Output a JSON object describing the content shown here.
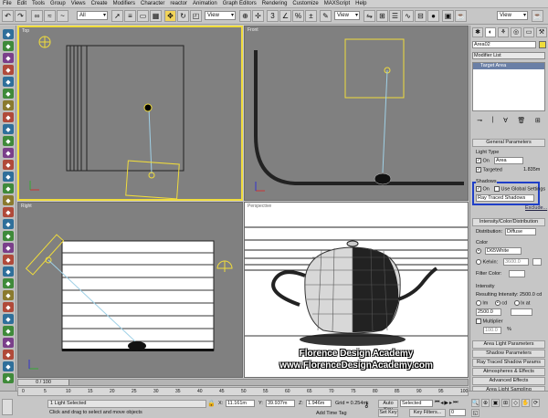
{
  "menu": [
    "File",
    "Edit",
    "Tools",
    "Group",
    "Views",
    "Create",
    "Modifiers",
    "Character",
    "reactor",
    "Animation",
    "Graph Editors",
    "Rendering",
    "Customize",
    "MAXScript",
    "Help"
  ],
  "toolbar": {
    "selection_filter": "All",
    "ref_coord": "View",
    "named_selection": "View"
  },
  "viewports": {
    "top": "Top",
    "front": "Front",
    "right": "Right",
    "perspective": "Perspective"
  },
  "command_panel": {
    "object_name": "Area02",
    "modifier_list": "Modifier List",
    "stack_item": "Target Area",
    "general_params": {
      "title": "General Parameters",
      "light_type_label": "Light Type",
      "on_label": "On",
      "type_value": "Area",
      "targeted_label": "Targeted",
      "targeted_value": "1.835m",
      "shadows_label": "Shadows",
      "shadows_on": "On",
      "use_global": "Use Global Settings",
      "shadow_type": "Ray Traced Shadows",
      "exclude": "Exclude..."
    },
    "intensity": {
      "title": "Intensity/Color/Distribution",
      "distribution_label": "Distribution:",
      "distribution_value": "Diffuse",
      "color_label": "Color",
      "color_preset": "D65White",
      "kelvin_label": "Kelvin:",
      "kelvin_value": "3600.0",
      "filter_label": "Filter Color:",
      "intensity_label": "Intensity",
      "resulting": "Resulting Intensity: 2500.0 cd",
      "lm": "lm",
      "cd": "cd",
      "lx": "lx at",
      "int_value": "2500.0",
      "multiplier_label": "Multiplier",
      "multiplier_value": "100.0",
      "percent": "%"
    },
    "rollouts": [
      "Area Light Parameters",
      "Shadow Parameters",
      "Ray Traced Shadow Params",
      "Atmospheres & Effects",
      "Advanced Effects",
      "Area Light Sampling"
    ]
  },
  "timeline": {
    "slider": "0 / 100",
    "ticks": [
      "0",
      "5",
      "10",
      "15",
      "20",
      "25",
      "30",
      "35",
      "40",
      "45",
      "50",
      "55",
      "60",
      "65",
      "70",
      "75",
      "80",
      "85",
      "90",
      "95",
      "100"
    ]
  },
  "status": {
    "selected": "1 Light Selected",
    "prompt": "Click and drag to select and move objects",
    "x_label": "X:",
    "x_value": "11.161m",
    "y_label": "Y:",
    "y_value": "39.937m",
    "z_label": "Z:",
    "z_value": "1.946m",
    "grid": "Grid = 0.254m",
    "add_time_tag": "Add Time Tag",
    "auto_key": "Auto Key",
    "set_key": "Set Key",
    "selected_dd": "Selected",
    "key_filters": "Key Filters...",
    "frame": "0"
  },
  "watermark": {
    "line1": "Florence Design Academy",
    "line2": "www.FlorenceDesignAcademy.com"
  }
}
